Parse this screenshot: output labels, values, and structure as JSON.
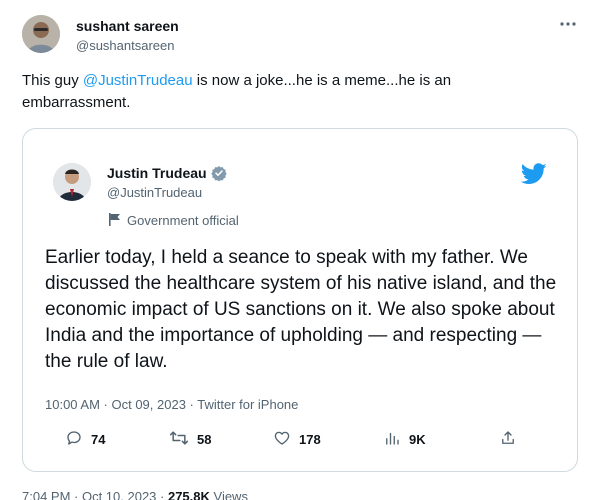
{
  "tweet": {
    "author_name": "sushant sareen",
    "author_handle": "@sushantsareen",
    "text_before": "This guy ",
    "mention": "@JustinTrudeau",
    "text_after": " is now a joke...he is a meme...he is an embarrassment.",
    "footer_time": "7:04 PM · Oct 10, 2023 · ",
    "footer_views_count": "275.8K",
    "footer_views_label": " Views"
  },
  "quoted": {
    "author_name": "Justin Trudeau",
    "author_handle": "@JustinTrudeau",
    "label": "Government official",
    "text": "Earlier today, I held a seance to speak with my father. We discussed the healthcare system of his native island, and the economic impact of US sanctions on it. We also spoke about India and the importance of upholding — and respecting — the rule of law.",
    "meta": "10:00 AM · Oct 09, 2023 · Twitter for iPhone",
    "replies": "74",
    "retweets": "58",
    "likes": "178",
    "views": "9K"
  },
  "icons": {
    "more": "more-horizontal-icon",
    "verified": "verified-badge-icon",
    "flag": "government-flag-icon",
    "brand": "twitter-bird-icon",
    "reply": "reply-icon",
    "retweet": "retweet-icon",
    "like": "heart-icon",
    "views": "views-bar-chart-icon",
    "share": "share-icon"
  },
  "colors": {
    "accent": "#1d9bf0",
    "text": "#0f1419",
    "secondary": "#536471",
    "border": "#cfd9de",
    "verified_gray": "#829aab"
  }
}
